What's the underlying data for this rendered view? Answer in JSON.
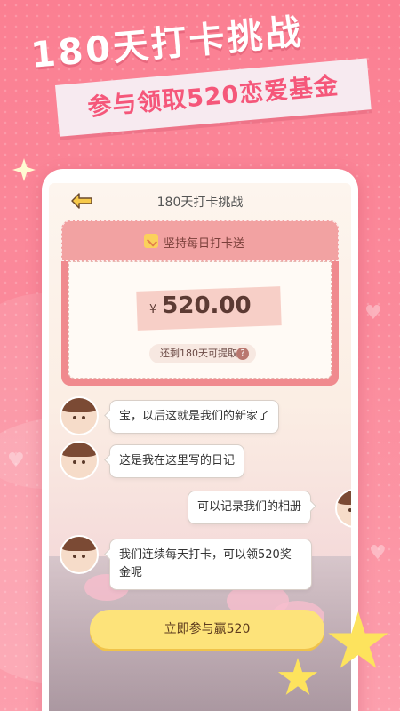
{
  "banner": {
    "title": "180天打卡挑战",
    "subtitle": "参与领取520恋爱基金"
  },
  "nav": {
    "back_icon": "back-arrow-icon",
    "title": "180天打卡挑战"
  },
  "card": {
    "header_label": "坚持每日打卡送",
    "calendar_icon": "calendar-check-icon",
    "currency": "¥",
    "amount": "520.00",
    "remaining_text": "还剩180天可提取",
    "help_icon": "?"
  },
  "chat": [
    {
      "side": "left",
      "text": "宝，以后这就是我们的新家了"
    },
    {
      "side": "left",
      "text": "这是我在这里写的日记"
    },
    {
      "side": "right",
      "text": "可以记录我们的相册"
    },
    {
      "side": "left",
      "text": "我们连续每天打卡，可以领520奖金呢"
    }
  ],
  "cta": {
    "label": "立即参与赢520"
  },
  "colors": {
    "background": "#fb7f92",
    "accent": "#f5577a",
    "button": "#fde37a",
    "card": "#f08a8e"
  }
}
